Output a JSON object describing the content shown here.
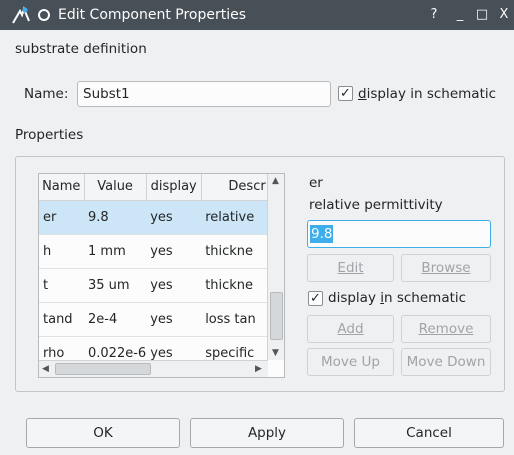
{
  "window": {
    "title": "Edit Component Properties",
    "help_label": "?",
    "minimize_label": "_",
    "maximize_label": "□",
    "close_label": "X"
  },
  "header": {
    "title": "substrate definition"
  },
  "name_row": {
    "label": "Name:",
    "value": "Subst1",
    "display_check": "✓",
    "display_prefix": "",
    "display_accel": "d",
    "display_rest": "isplay in schematic"
  },
  "properties": {
    "title": "Properties",
    "columns": [
      "Name",
      "Value",
      "display",
      "Descr"
    ],
    "rows": [
      {
        "name": "er",
        "value": "9.8",
        "display": "yes",
        "desc": "relative"
      },
      {
        "name": "h",
        "value": "1 mm",
        "display": "yes",
        "desc": "thickne"
      },
      {
        "name": "t",
        "value": "35 um",
        "display": "yes",
        "desc": "thickne"
      },
      {
        "name": "tand",
        "value": "2e-4",
        "display": "yes",
        "desc": "loss tan"
      },
      {
        "name": "rho",
        "value": "0.022e-6",
        "display": "yes",
        "desc": "specific"
      }
    ],
    "selected_row": 0
  },
  "editor": {
    "prop_name": "er",
    "prop_desc": "relative permittivity",
    "prop_value": "9.8",
    "edit_label": "Edit",
    "browse_label": "Browse",
    "display_check": "✓",
    "display_prefix": "display ",
    "display_accel": "i",
    "display_rest": "n schematic",
    "add_label": "Add",
    "remove_label": "Remove",
    "move_up_label": "Move Up",
    "move_down_label": "Move Down"
  },
  "footer": {
    "ok_label": "OK",
    "apply_label": "Apply",
    "cancel_label": "Cancel"
  }
}
